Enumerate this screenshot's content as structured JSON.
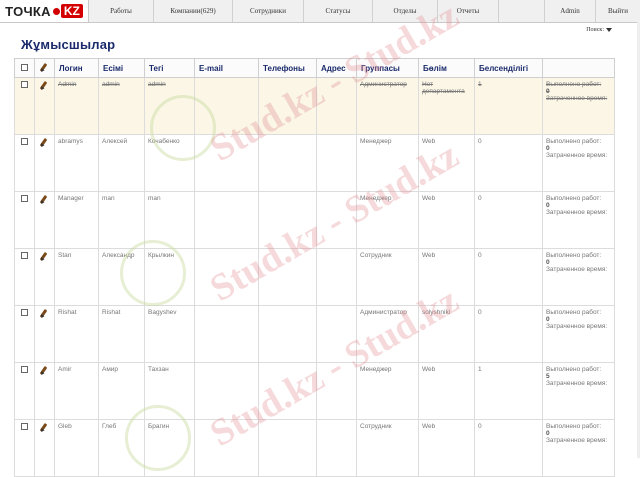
{
  "app": {
    "logo_main": "ТОЧКА",
    "logo_kz": "KZ"
  },
  "nav": {
    "items": [
      "Работы",
      "Компании(629)",
      "Сотрудники",
      "Статусы",
      "Отделы",
      "Отчеты"
    ],
    "admin": "Admin",
    "logout": "Выйти"
  },
  "page": {
    "title": "Жұмысшылар",
    "search": "Поиск:"
  },
  "table": {
    "headers": [
      "Логин",
      "Есімі",
      "Тегі",
      "E-mail",
      "Телефоны",
      "Адрес",
      "Группасы",
      "Бөлім",
      "Белсенділігі",
      ""
    ],
    "rows": [
      {
        "login": "Admin",
        "name": "admin",
        "surname": "admin",
        "email": "",
        "phone": "",
        "address": "",
        "group": "Администратор",
        "department": "Нет департамента",
        "activity": "1",
        "status_title": "Выполнено работ:",
        "status_count": "0",
        "status_spent": "Затраченное время:"
      },
      {
        "login": "abramys",
        "name": "Алексей",
        "surname": "Кочабенко",
        "email": "",
        "phone": "",
        "address": "",
        "group": "Менеджер",
        "department": "Web",
        "activity": "0",
        "status_title": "Выполнено работ:",
        "status_count": "0",
        "status_spent": "Затраченное время:"
      },
      {
        "login": "Manager",
        "name": "man",
        "surname": "man",
        "email": "",
        "phone": "",
        "address": "",
        "group": "Менеджер",
        "department": "Web",
        "activity": "0",
        "status_title": "Выполнено работ:",
        "status_count": "0",
        "status_spent": "Затраченное время:"
      },
      {
        "login": "Stan",
        "name": "Александр",
        "surname": "Крылкин",
        "email": "",
        "phone": "",
        "address": "",
        "group": "Сотрудник",
        "department": "Web",
        "activity": "0",
        "status_title": "Выполнено работ:",
        "status_count": "0",
        "status_spent": "Затраченное время:"
      },
      {
        "login": "Rishat",
        "name": "Rishat",
        "surname": "Bagyshev",
        "email": "",
        "phone": "",
        "address": "",
        "group": "Администратор",
        "department": "solyshniki",
        "activity": "0",
        "status_title": "Выполнено работ:",
        "status_count": "0",
        "status_spent": "Затраченное время:"
      },
      {
        "login": "Amir",
        "name": "Амир",
        "surname": "Тахзан",
        "email": "",
        "phone": "",
        "address": "",
        "group": "Менеджер",
        "department": "Web",
        "activity": "1",
        "status_title": "Выполнено работ:",
        "status_count": "5",
        "status_spent": "Затраченное время:"
      },
      {
        "login": "Gleb",
        "name": "Глеб",
        "surname": "Брагин",
        "email": "",
        "phone": "",
        "address": "",
        "group": "Сотрудник",
        "department": "Web",
        "activity": "0",
        "status_title": "Выполнено работ:",
        "status_count": "0",
        "status_spent": "Затраченное время:"
      }
    ]
  },
  "watermark": {
    "text": "Stud.kz - Stud.kz"
  }
}
